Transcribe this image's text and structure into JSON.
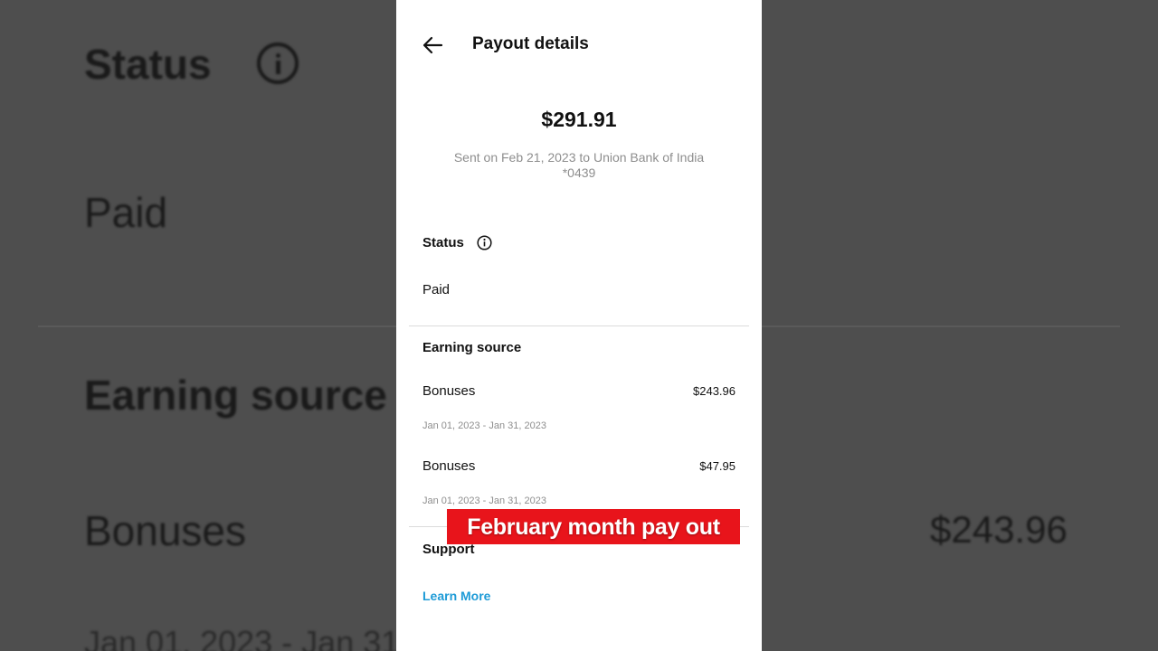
{
  "background": {
    "status_label": "Status",
    "paid_label": "Paid",
    "earning_label": "Earning source",
    "bonuses_label": "Bonuses",
    "amount": "$243.96",
    "date_range": "Jan 01, 2023 - Jan 31"
  },
  "header": {
    "title": "Payout details",
    "back_icon": "arrow-left-icon"
  },
  "summary": {
    "amount": "$291.91",
    "sent_text": "Sent on Feb 21, 2023 to Union Bank of India *0439"
  },
  "status": {
    "label": "Status",
    "info_icon": "info-icon",
    "value": "Paid"
  },
  "earning_source": {
    "label": "Earning source",
    "items": [
      {
        "title": "Bonuses",
        "amount": "$243.96",
        "date_range": "Jan 01, 2023 - Jan 31, 2023"
      },
      {
        "title": "Bonuses",
        "amount": "$47.95",
        "date_range": "Jan 01, 2023 - Jan 31, 2023"
      }
    ]
  },
  "support": {
    "label": "Support",
    "link": "Learn More",
    "link_color": "#1e9bd7"
  },
  "overlay": {
    "caption": "February month pay out",
    "background_color": "#e8141b"
  }
}
